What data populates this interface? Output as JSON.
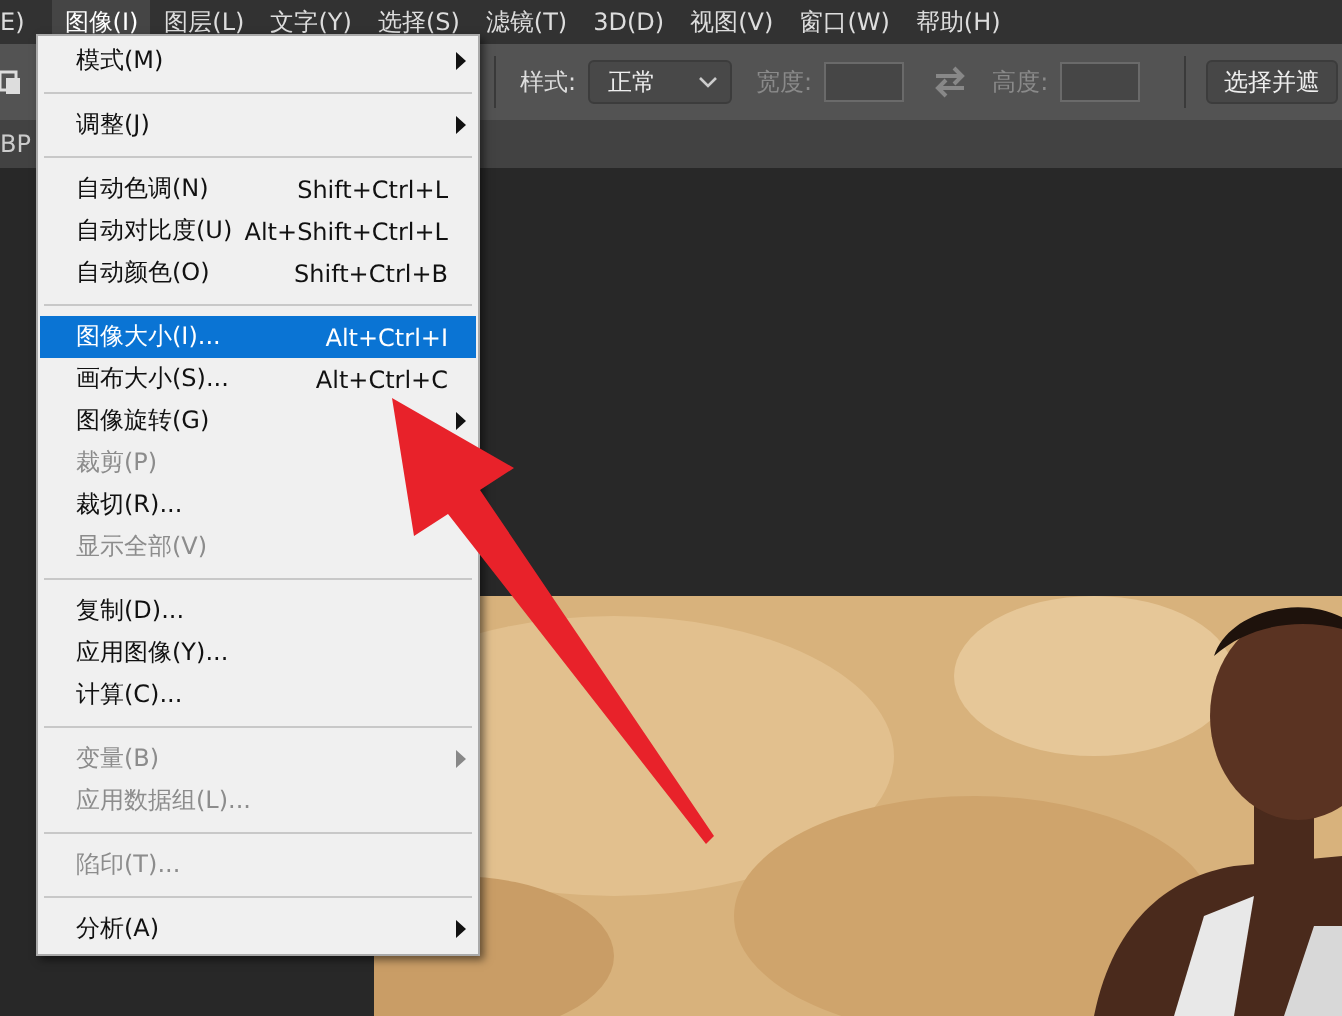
{
  "menubar": [
    {
      "label": "E)",
      "selected": false
    },
    {
      "label": "图像(I)",
      "selected": true
    },
    {
      "label": "图层(L)",
      "selected": false
    },
    {
      "label": "文字(Y)",
      "selected": false
    },
    {
      "label": "选择(S)",
      "selected": false
    },
    {
      "label": "滤镜(T)",
      "selected": false
    },
    {
      "label": "3D(D)",
      "selected": false
    },
    {
      "label": "视图(V)",
      "selected": false
    },
    {
      "label": "窗口(W)",
      "selected": false
    },
    {
      "label": "帮助(H)",
      "selected": false
    }
  ],
  "options_bar": {
    "style_label": "样式:",
    "style_value": "正常",
    "width_label": "宽度:",
    "height_label": "高度:",
    "button": "选择并遮"
  },
  "document_tab": "BP",
  "menu": [
    {
      "kind": "item",
      "label": "模式(M)",
      "submenu": true,
      "disabled": false,
      "selected": false
    },
    {
      "kind": "separator"
    },
    {
      "kind": "item",
      "label": "调整(J)",
      "submenu": true,
      "disabled": false,
      "selected": false
    },
    {
      "kind": "separator"
    },
    {
      "kind": "item",
      "label": "自动色调(N)",
      "shortcut": "Shift+Ctrl+L",
      "submenu": false,
      "disabled": false,
      "selected": false
    },
    {
      "kind": "item",
      "label": "自动对比度(U)",
      "shortcut": "Alt+Shift+Ctrl+L",
      "submenu": false,
      "disabled": false,
      "selected": false
    },
    {
      "kind": "item",
      "label": "自动颜色(O)",
      "shortcut": "Shift+Ctrl+B",
      "submenu": false,
      "disabled": false,
      "selected": false
    },
    {
      "kind": "separator"
    },
    {
      "kind": "item",
      "label": "图像大小(I)...",
      "shortcut": "Alt+Ctrl+I",
      "submenu": false,
      "disabled": false,
      "selected": true
    },
    {
      "kind": "item",
      "label": "画布大小(S)...",
      "shortcut": "Alt+Ctrl+C",
      "submenu": false,
      "disabled": false,
      "selected": false
    },
    {
      "kind": "item",
      "label": "图像旋转(G)",
      "submenu": true,
      "disabled": false,
      "selected": false
    },
    {
      "kind": "item",
      "label": "裁剪(P)",
      "submenu": false,
      "disabled": true,
      "selected": false
    },
    {
      "kind": "item",
      "label": "裁切(R)...",
      "submenu": false,
      "disabled": false,
      "selected": false
    },
    {
      "kind": "item",
      "label": "显示全部(V)",
      "submenu": false,
      "disabled": true,
      "selected": false
    },
    {
      "kind": "separator"
    },
    {
      "kind": "item",
      "label": "复制(D)...",
      "submenu": false,
      "disabled": false,
      "selected": false
    },
    {
      "kind": "item",
      "label": "应用图像(Y)...",
      "submenu": false,
      "disabled": false,
      "selected": false
    },
    {
      "kind": "item",
      "label": "计算(C)...",
      "submenu": false,
      "disabled": false,
      "selected": false
    },
    {
      "kind": "separator"
    },
    {
      "kind": "item",
      "label": "变量(B)",
      "submenu": true,
      "disabled": true,
      "selected": false
    },
    {
      "kind": "item",
      "label": "应用数据组(L)...",
      "submenu": false,
      "disabled": true,
      "selected": false
    },
    {
      "kind": "separator"
    },
    {
      "kind": "item",
      "label": "陷印(T)...",
      "submenu": false,
      "disabled": true,
      "selected": false
    },
    {
      "kind": "separator"
    },
    {
      "kind": "item",
      "label": "分析(A)",
      "submenu": true,
      "disabled": false,
      "selected": false
    }
  ]
}
